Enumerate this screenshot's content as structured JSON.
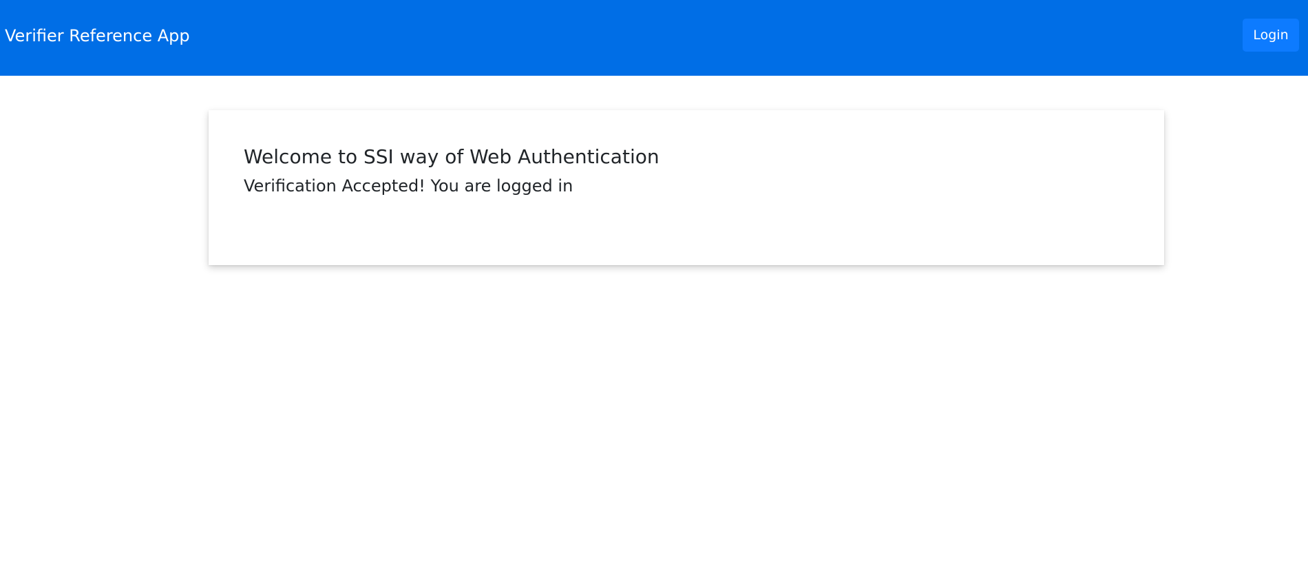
{
  "navbar": {
    "brand": "Verifier Reference App",
    "login_label": "Login"
  },
  "card": {
    "title": "Welcome to SSI way of Web Authentication",
    "message": "Verification Accepted! You are logged in"
  },
  "colors": {
    "navbar_bg": "#006ee6",
    "button_bg": "#0d7bff",
    "text": "#212529"
  }
}
